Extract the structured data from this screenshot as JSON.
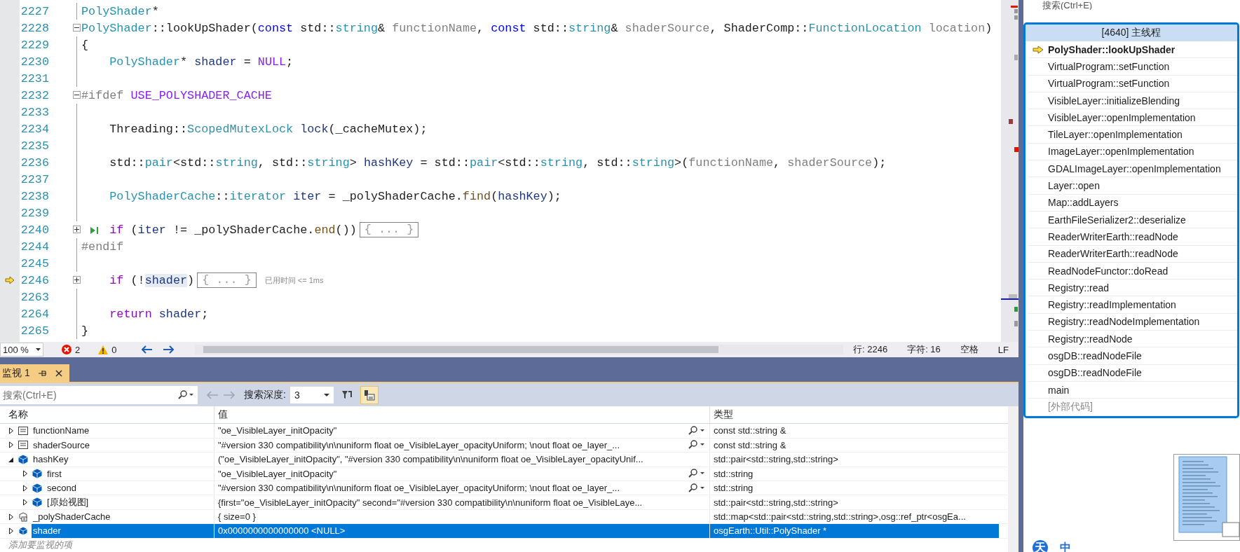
{
  "editor": {
    "lines": [
      {
        "number": "2227",
        "indented": false,
        "tokens": [
          {
            "kind": "type",
            "text": "PolyShader"
          },
          {
            "kind": "plain",
            "text": "*"
          }
        ]
      },
      {
        "number": "2228",
        "indented": false,
        "collapsed": false,
        "tokens": [
          {
            "kind": "type",
            "text": "PolyShader"
          },
          {
            "kind": "plain",
            "text": "::lookUpShader("
          },
          {
            "kind": "keyword",
            "text": "const"
          },
          {
            "kind": "plain",
            "text": " std::"
          },
          {
            "kind": "type",
            "text": "string"
          },
          {
            "kind": "plain",
            "text": "& "
          },
          {
            "kind": "param",
            "text": "functionName"
          },
          {
            "kind": "plain",
            "text": ", "
          },
          {
            "kind": "keyword",
            "text": "const"
          },
          {
            "kind": "plain",
            "text": " std::"
          },
          {
            "kind": "type",
            "text": "string"
          },
          {
            "kind": "plain",
            "text": "& "
          },
          {
            "kind": "param",
            "text": "shaderSource"
          },
          {
            "kind": "plain",
            "text": ", ShaderComp::"
          },
          {
            "kind": "type",
            "text": "FunctionLocation"
          },
          {
            "kind": "param",
            "text": " location"
          },
          {
            "kind": "plain",
            "text": ")"
          }
        ]
      },
      {
        "number": "2229",
        "indented": false,
        "tokens": [
          {
            "kind": "plain",
            "text": "{"
          }
        ]
      },
      {
        "number": "2230",
        "indented": true,
        "tokens": [
          {
            "kind": "type",
            "text": "PolyShader"
          },
          {
            "kind": "plain",
            "text": "* "
          },
          {
            "kind": "local",
            "text": "shader"
          },
          {
            "kind": "plain",
            "text": " = "
          },
          {
            "kind": "macro",
            "text": "NULL"
          },
          {
            "kind": "plain",
            "text": ";"
          }
        ]
      },
      {
        "number": "2231"
      },
      {
        "number": "2232",
        "indented": false,
        "collapsed": false,
        "tokens": [
          {
            "kind": "preprocessor",
            "text": "#ifdef "
          },
          {
            "kind": "macro",
            "text": "USE_POLYSHADER_CACHE"
          }
        ]
      },
      {
        "number": "2233"
      },
      {
        "number": "2234",
        "indented": true,
        "tokens": [
          {
            "kind": "plain",
            "text": "Threading::"
          },
          {
            "kind": "type",
            "text": "ScopedMutexLock"
          },
          {
            "kind": "local",
            "text": " lock"
          },
          {
            "kind": "plain",
            "text": "(_cacheMutex);"
          }
        ]
      },
      {
        "number": "2235"
      },
      {
        "number": "2236",
        "indented": true,
        "tokens": [
          {
            "kind": "plain",
            "text": "std::"
          },
          {
            "kind": "type",
            "text": "pair"
          },
          {
            "kind": "plain",
            "text": "<std::"
          },
          {
            "kind": "type",
            "text": "string"
          },
          {
            "kind": "plain",
            "text": ", std::"
          },
          {
            "kind": "type",
            "text": "string"
          },
          {
            "kind": "plain",
            "text": ">"
          },
          {
            "kind": "local",
            "text": " hashKey"
          },
          {
            "kind": "plain",
            "text": " = std::"
          },
          {
            "kind": "type",
            "text": "pair"
          },
          {
            "kind": "plain",
            "text": "<std::"
          },
          {
            "kind": "type",
            "text": "string"
          },
          {
            "kind": "plain",
            "text": ", std::"
          },
          {
            "kind": "type",
            "text": "string"
          },
          {
            "kind": "plain",
            "text": ">("
          },
          {
            "kind": "param",
            "text": "functionName"
          },
          {
            "kind": "plain",
            "text": ", "
          },
          {
            "kind": "param",
            "text": "shaderSource"
          },
          {
            "kind": "plain",
            "text": ");"
          }
        ]
      },
      {
        "number": "2237"
      },
      {
        "number": "2238",
        "indented": true,
        "tokens": [
          {
            "kind": "type",
            "text": "PolyShaderCache"
          },
          {
            "kind": "plain",
            "text": "::"
          },
          {
            "kind": "type",
            "text": "iterator"
          },
          {
            "kind": "local",
            "text": " iter"
          },
          {
            "kind": "plain",
            "text": " = _polyShaderCache."
          },
          {
            "kind": "method",
            "text": "find"
          },
          {
            "kind": "plain",
            "text": "("
          },
          {
            "kind": "local",
            "text": "hashKey"
          },
          {
            "kind": "plain",
            "text": ");"
          }
        ]
      },
      {
        "number": "2239"
      },
      {
        "number": "2240",
        "indented": true,
        "collapsed": true,
        "run_to_click": true,
        "tokens": [
          {
            "kind": "control",
            "text": "if"
          },
          {
            "kind": "plain",
            "text": " ("
          },
          {
            "kind": "local",
            "text": "iter"
          },
          {
            "kind": "plain",
            "text": " != _polyShaderCache."
          },
          {
            "kind": "method",
            "text": "end"
          },
          {
            "kind": "plain",
            "text": "())"
          },
          {
            "kind": "collapsed",
            "text": "{ ... }"
          }
        ]
      },
      {
        "number": "2244",
        "indented": false,
        "tokens": [
          {
            "kind": "preprocessor",
            "text": "#endif"
          }
        ]
      },
      {
        "number": "2245"
      },
      {
        "number": "2246",
        "indented": true,
        "collapsed": true,
        "current": true,
        "tokens": [
          {
            "kind": "control",
            "text": "if"
          },
          {
            "kind": "plain",
            "text": " (!"
          },
          {
            "kind": "highlight",
            "text": "shader"
          },
          {
            "kind": "plain",
            "text": ")"
          },
          {
            "kind": "collapsed",
            "text": "{ ... }"
          },
          {
            "kind": "hint",
            "text": "已用时间 <= 1ms"
          }
        ]
      },
      {
        "number": "2263"
      },
      {
        "number": "2264",
        "indented": true,
        "tokens": [
          {
            "kind": "control",
            "text": "return"
          },
          {
            "kind": "local",
            "text": " shader"
          },
          {
            "kind": "plain",
            "text": ";"
          }
        ]
      },
      {
        "number": "2265",
        "indented": false,
        "tokens": [
          {
            "kind": "plain",
            "text": "}"
          }
        ]
      }
    ]
  },
  "status_strip": {
    "zoom": "100 %",
    "errors": "2",
    "warnings": "0",
    "line": "行: 2246",
    "column": "字符: 16",
    "indent": "空格",
    "line_ending": "LF"
  },
  "watch": {
    "tab": {
      "label": "监视 1",
      "selected": true
    },
    "search": {
      "placeholder": "搜索(Ctrl+E)"
    },
    "depth_label": "搜索深度:",
    "depth": "3",
    "tool_buttons": [
      {
        "kind": "filter",
        "on": false
      },
      {
        "kind": "hex",
        "on": true
      }
    ],
    "columns": [
      "名称",
      "值",
      "类型"
    ],
    "rows": [
      {
        "name": "functionName",
        "value": "\"oe_VisibleLayer_initOpacity\"",
        "type": "const std::string &",
        "kind": "reference",
        "visualizer": true,
        "expanded": false,
        "selected": false
      },
      {
        "name": "shaderSource",
        "value": "\"#version 330 compatibility\\n\\nuniform float oe_VisibleLayer_opacityUniform; \\nout float oe_layer_...",
        "type": "const std::string &",
        "kind": "reference",
        "visualizer": true,
        "expanded": false,
        "selected": false
      },
      {
        "name": "hashKey",
        "value": "(\"oe_VisibleLayer_initOpacity\", \"#version 330 compatibility\\n\\nuniform float oe_VisibleLayer_opacityUnif...",
        "type": "std::pair<std::string,std::string>",
        "kind": "object",
        "visualizer": false,
        "expanded": true,
        "selected": false,
        "children": [
          {
            "name": "first",
            "value": "\"oe_VisibleLayer_initOpacity\"",
            "type": "std::string",
            "kind": "object",
            "visualizer": true,
            "expanded": false,
            "selected": false
          },
          {
            "name": "second",
            "value": "\"#version 330 compatibility\\n\\nuniform float oe_VisibleLayer_opacityUniform; \\nout float oe_layer_...",
            "type": "std::string",
            "kind": "object",
            "visualizer": true,
            "expanded": false,
            "selected": false
          },
          {
            "name": "[原始视图]",
            "value": "{first=\"oe_VisibleLayer_initOpacity\" second=\"#version 330 compatibility\\n\\nuniform float oe_VisibleLaye...",
            "type": "std::pair<std::string,std::string>",
            "kind": "object",
            "visualizer": false,
            "expanded": false,
            "selected": false
          }
        ]
      },
      {
        "name": "_polyShaderCache",
        "value": "{ size=0 }",
        "type": "std::map<std::pair<std::string,std::string>,osg::ref_ptr<osgEa...",
        "kind": "static",
        "visualizer": false,
        "expanded": false,
        "selected": false
      },
      {
        "name": "shader",
        "value": "0x0000000000000000 <NULL>",
        "type": "osgEarth::Util::PolyShader *",
        "kind": "object",
        "visualizer": false,
        "expanded": false,
        "selected": true
      }
    ],
    "add_placeholder": "添加要监视的项"
  },
  "side_search": {
    "placeholder": "搜索(Ctrl+E)"
  },
  "call_stack": {
    "title": "[4640] 主线程",
    "frames": [
      {
        "name": "PolyShader::lookUpShader",
        "kind": "current"
      },
      {
        "name": "VirtualProgram::setFunction",
        "kind": "frame"
      },
      {
        "name": "VirtualProgram::setFunction",
        "kind": "frame"
      },
      {
        "name": "VisibleLayer::initializeBlending",
        "kind": "frame"
      },
      {
        "name": "VisibleLayer::openImplementation",
        "kind": "frame"
      },
      {
        "name": "TileLayer::openImplementation",
        "kind": "frame"
      },
      {
        "name": "ImageLayer::openImplementation",
        "kind": "frame"
      },
      {
        "name": "GDALImageLayer::openImplementation",
        "kind": "frame"
      },
      {
        "name": "Layer::open",
        "kind": "frame"
      },
      {
        "name": "Map::addLayers",
        "kind": "frame"
      },
      {
        "name": "EarthFileSerializer2::deserialize",
        "kind": "frame"
      },
      {
        "name": "ReaderWriterEarth::readNode",
        "kind": "frame"
      },
      {
        "name": "ReaderWriterEarth::readNode",
        "kind": "frame"
      },
      {
        "name": "ReadNodeFunctor::doRead",
        "kind": "frame"
      },
      {
        "name": "Registry::read",
        "kind": "frame"
      },
      {
        "name": "Registry::readImplementation",
        "kind": "frame"
      },
      {
        "name": "Registry::readNodeImplementation",
        "kind": "frame"
      },
      {
        "name": "Registry::readNode",
        "kind": "frame"
      },
      {
        "name": "osgDB::readNodeFile",
        "kind": "frame"
      },
      {
        "name": "osgDB::readNodeFile",
        "kind": "frame"
      },
      {
        "name": "main",
        "kind": "frame"
      },
      {
        "name": "[外部代码]",
        "kind": "external"
      }
    ]
  },
  "ime_bar": {
    "items": [
      "天",
      "中"
    ]
  }
}
